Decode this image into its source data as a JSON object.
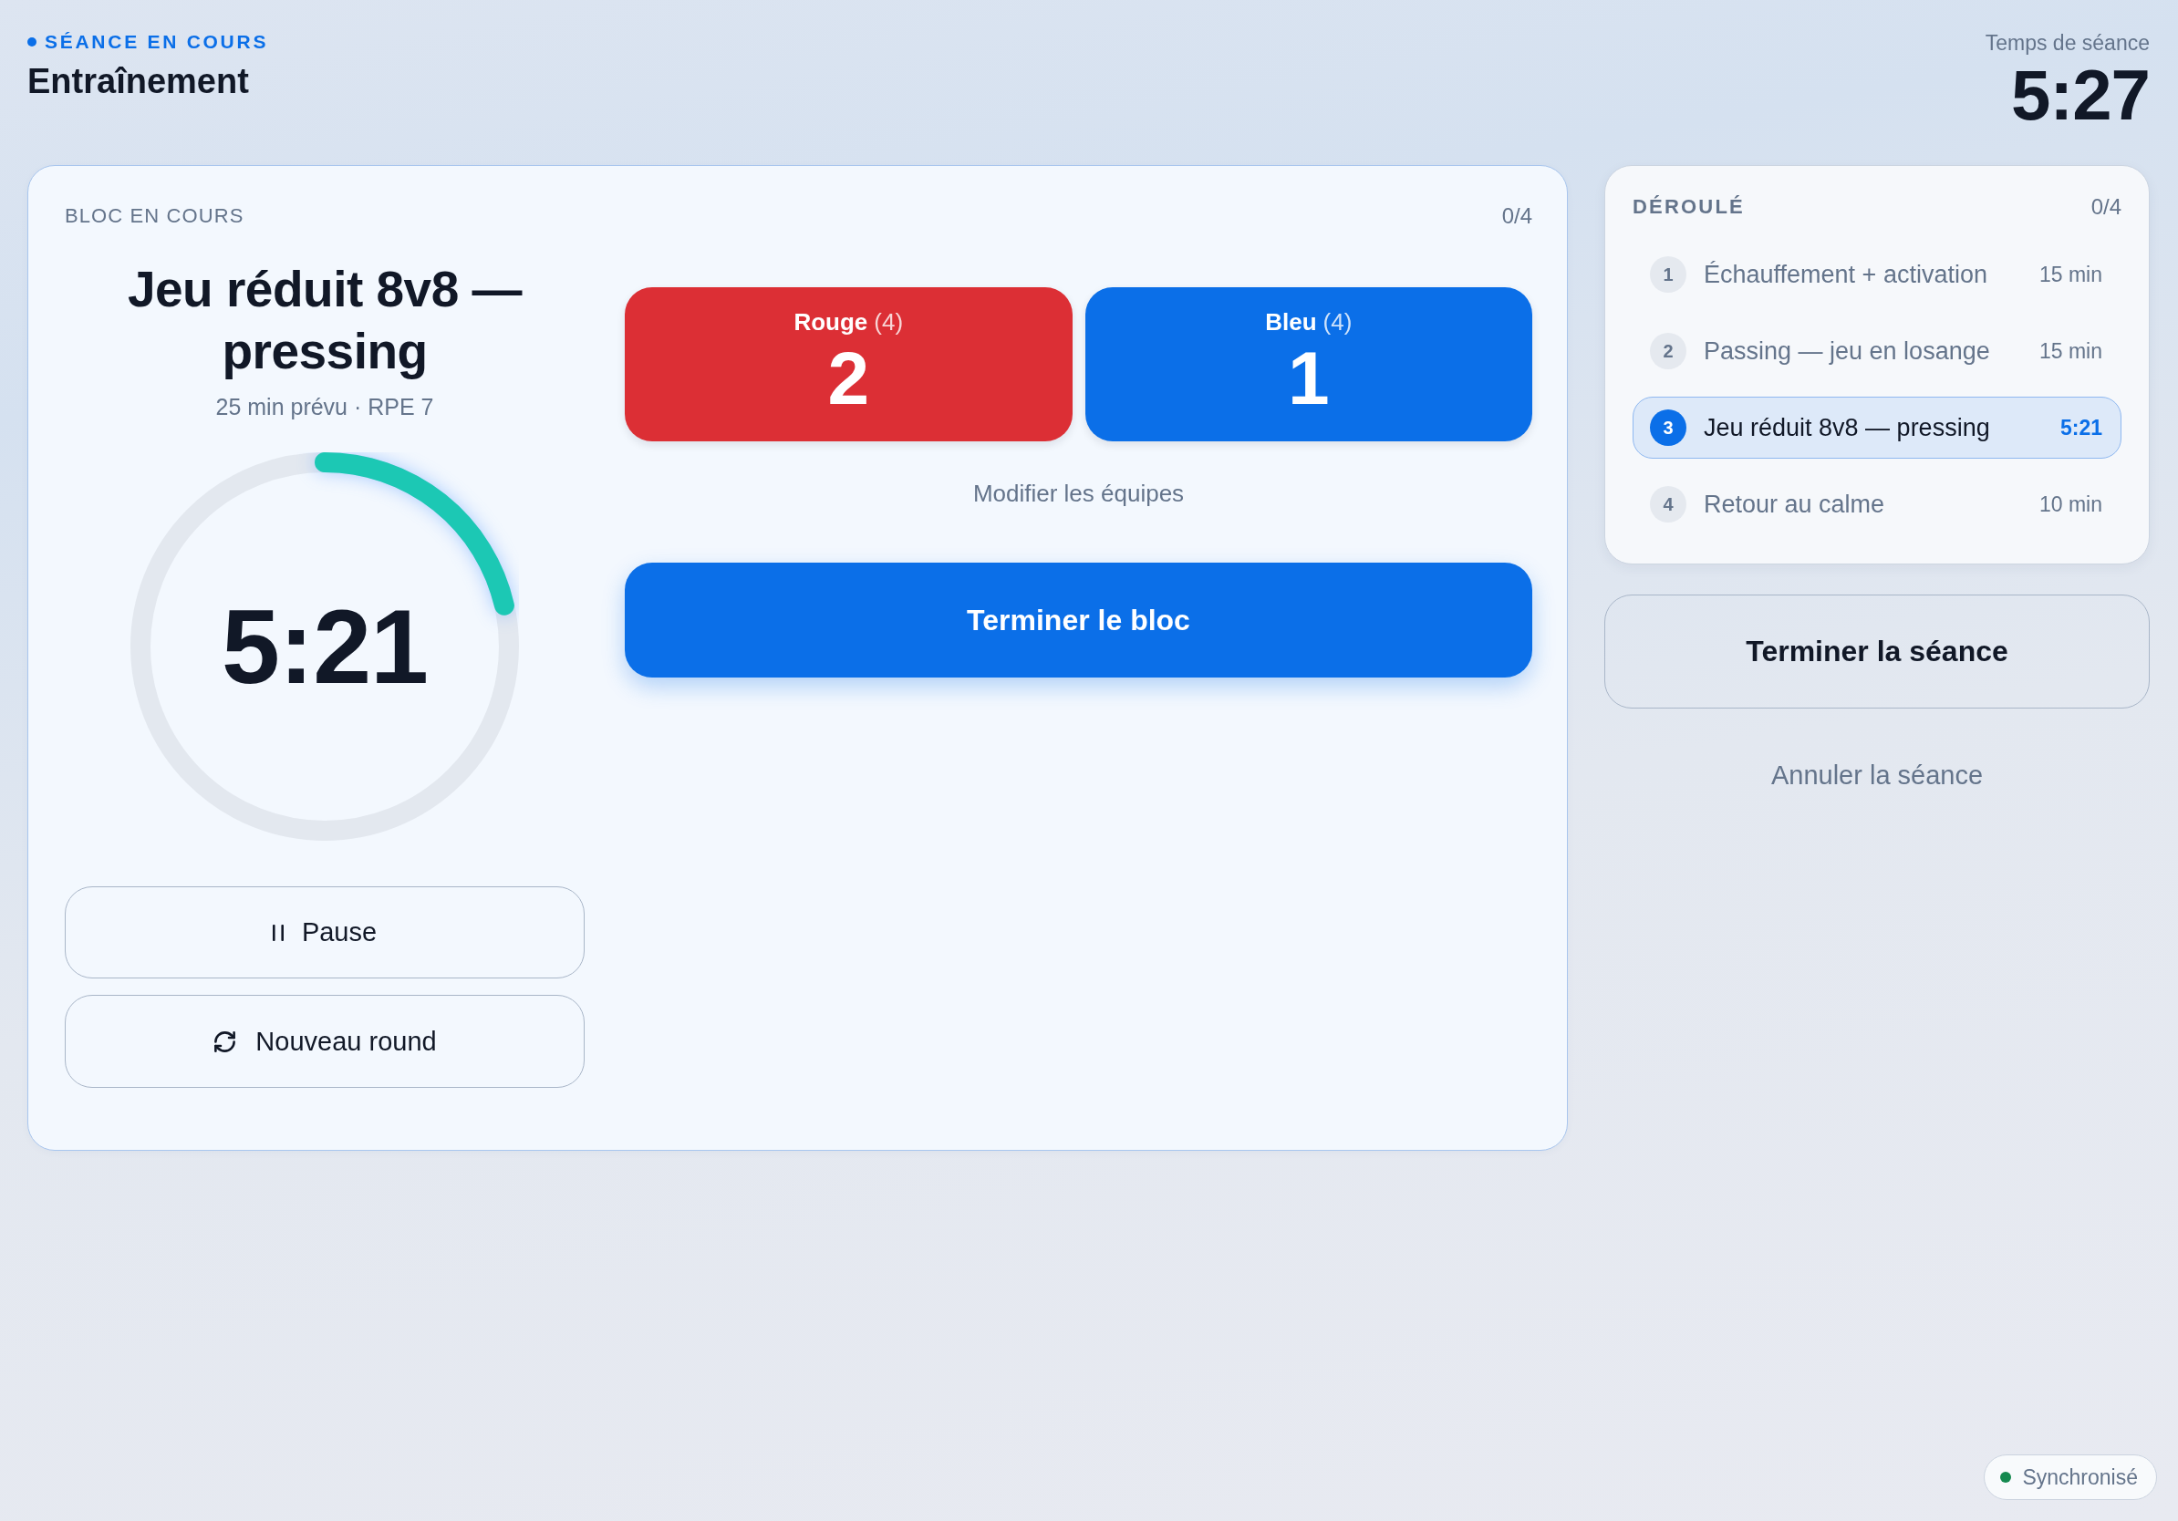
{
  "header": {
    "status": "SÉANCE EN COURS",
    "title": "Entraînement",
    "timer_label": "Temps de séance",
    "timer": "5:27"
  },
  "current_block": {
    "label": "BLOC EN COURS",
    "progress": "0/4",
    "title": "Jeu réduit 8v8 — pressing",
    "meta": "25 min prévu · RPE 7",
    "countdown": {
      "time": "5:21",
      "level": 0.214
    },
    "pause_button": "Pause",
    "new_round_button": "Nouveau round",
    "teams": [
      {
        "name": "Rouge",
        "count": "(4)",
        "score": "2",
        "color": "#dc2f35"
      },
      {
        "name": "Bleu",
        "count": "(4)",
        "score": "1",
        "color": "#0b6fe8"
      }
    ],
    "edit_teams": "Modifier les équipes",
    "finish_block": "Terminer le bloc"
  },
  "plan": {
    "title": "DÉROULÉ",
    "progress": "0/4",
    "items": [
      {
        "number": "1",
        "name": "Échauffement + activation",
        "duration": "15 min",
        "selected": false
      },
      {
        "number": "2",
        "name": "Passing — jeu en losange",
        "duration": "15 min",
        "selected": false
      },
      {
        "number": "3",
        "name": "Jeu réduit 8v8 — pressing",
        "duration": "5:21",
        "selected": true
      },
      {
        "number": "4",
        "name": "Retour au calme",
        "duration": "10 min",
        "selected": false
      }
    ]
  },
  "finish_session": "Terminer la séance",
  "cancel_session": "Annuler la séance",
  "sync_status": "Synchronisé"
}
